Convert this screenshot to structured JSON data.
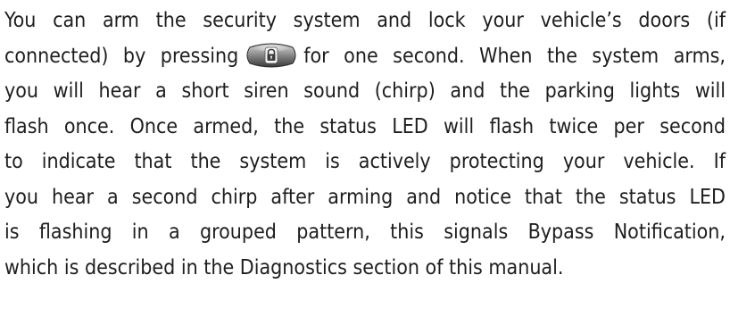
{
  "paragraph": {
    "line1": "You can arm the security system and lock your vehicle’s doors (if",
    "line2_before_icon": "connected) by pressing",
    "line2_after_icon": "for one second. When the system arms,",
    "line3": "you will hear a short siren sound (chirp) and the parking lights will",
    "line4": "flash once. Once armed, the status LED will flash twice per second",
    "line5": "to indicate that the system is actively protecting your vehicle. If",
    "line6": "you hear a second chirp after arming and notice that the status LED",
    "line7": "is flashing in a grouped pattern, this signals Bypass Notification,",
    "line8": "which is described in the Diagnostics section of this manual."
  },
  "icons": {
    "lock_button": "lock-button-icon"
  }
}
